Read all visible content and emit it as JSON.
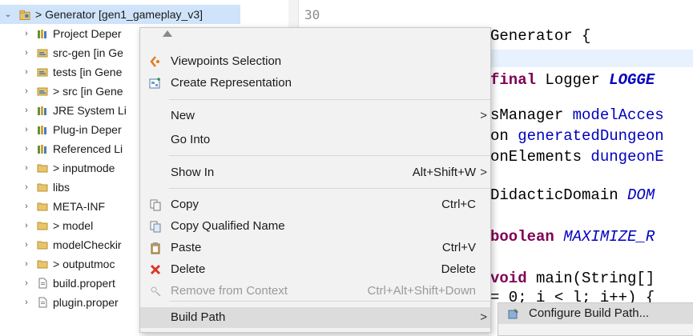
{
  "tree": {
    "root": {
      "prefix": "> ",
      "name": "Generator",
      "detail": "[gen1_gameplay_v3]"
    },
    "items": [
      {
        "label": "Project Deper",
        "icon": "library-icon"
      },
      {
        "label": "src-gen [in Ge",
        "icon": "source-folder-icon"
      },
      {
        "label": "tests [in Gene",
        "icon": "source-folder-icon"
      },
      {
        "label": "> src [in Gene",
        "icon": "source-folder-icon"
      },
      {
        "label": "JRE System Li",
        "icon": "library-icon"
      },
      {
        "label": "Plug-in Deper",
        "icon": "library-icon"
      },
      {
        "label": "Referenced Li",
        "icon": "library-icon"
      },
      {
        "label": "> inputmode",
        "icon": "folder-icon"
      },
      {
        "label": "libs",
        "icon": "folder-icon"
      },
      {
        "label": "META-INF",
        "icon": "folder-icon"
      },
      {
        "label": "> model",
        "icon": "folder-icon"
      },
      {
        "label": "modelCheckir",
        "icon": "folder-icon"
      },
      {
        "label": "> outputmoc",
        "icon": "folder-icon"
      },
      {
        "label": "build.propert",
        "icon": "file-icon"
      },
      {
        "label": "plugin.proper",
        "icon": "file-icon"
      }
    ]
  },
  "editor": {
    "line_number": "30",
    "lines": [
      {
        "parts": [
          {
            "t": "Generator {",
            "c": ""
          }
        ]
      },
      {
        "parts": [
          {
            "t": "final",
            "c": "kw"
          },
          {
            "t": " Logger ",
            "c": ""
          },
          {
            "t": "LOGGE",
            "c": "sfld"
          }
        ]
      },
      {
        "parts": [
          {
            "t": "sManager ",
            "c": ""
          },
          {
            "t": "modelAcces",
            "c": "fld"
          }
        ]
      },
      {
        "parts": [
          {
            "t": "on ",
            "c": ""
          },
          {
            "t": "generatedDungeon",
            "c": "fld"
          }
        ]
      },
      {
        "parts": [
          {
            "t": "onElements ",
            "c": ""
          },
          {
            "t": "dungeonE",
            "c": "fld"
          }
        ]
      },
      {
        "parts": [
          {
            "t": "DidacticDomain ",
            "c": ""
          },
          {
            "t": "DOM",
            "c": "sfld2"
          }
        ]
      },
      {
        "parts": [
          {
            "t": "boolean",
            "c": "kw"
          },
          {
            "t": " ",
            "c": ""
          },
          {
            "t": "MAXIMIZE_R",
            "c": "sfld2"
          }
        ]
      },
      {
        "parts": [
          {
            "t": "void",
            "c": "kw"
          },
          {
            "t": " main(String[]",
            "c": ""
          }
        ]
      },
      {
        "parts": [
          {
            "t": "= 0; i < l; i++) {",
            "c": ""
          }
        ]
      }
    ]
  },
  "menu": {
    "items": [
      {
        "label": "Viewpoints Selection",
        "icon": "viewpoints-icon",
        "shortcut": "",
        "submenu": false,
        "disabled": false
      },
      {
        "label": "Create Representation",
        "icon": "create-representation-icon",
        "shortcut": "",
        "submenu": false,
        "disabled": false
      },
      {
        "label": "New",
        "icon": "",
        "shortcut": "",
        "submenu": true,
        "disabled": false
      },
      {
        "label": "Go Into",
        "icon": "",
        "shortcut": "",
        "submenu": false,
        "disabled": false
      },
      {
        "label": "Show In",
        "icon": "",
        "shortcut": "Alt+Shift+W",
        "submenu": true,
        "disabled": false
      },
      {
        "label": "Copy",
        "icon": "copy-icon",
        "shortcut": "Ctrl+C",
        "submenu": false,
        "disabled": false
      },
      {
        "label": "Copy Qualified Name",
        "icon": "copy-qualified-name-icon",
        "shortcut": "",
        "submenu": false,
        "disabled": false
      },
      {
        "label": "Paste",
        "icon": "paste-icon",
        "shortcut": "Ctrl+V",
        "submenu": false,
        "disabled": false
      },
      {
        "label": "Delete",
        "icon": "delete-icon",
        "shortcut": "Delete",
        "submenu": false,
        "disabled": false
      },
      {
        "label": "Remove from Context",
        "icon": "remove-context-icon",
        "shortcut": "Ctrl+Alt+Shift+Down",
        "submenu": false,
        "disabled": true
      },
      {
        "label": "Build Path",
        "icon": "",
        "shortcut": "",
        "submenu": true,
        "disabled": false
      }
    ],
    "arrow_glyph": ">"
  },
  "submenu": {
    "items": [
      {
        "label": "Configure Build Path...",
        "icon": "configure-build-path-icon"
      }
    ]
  },
  "colors": {
    "menu_bg": "#f2f2f2",
    "hover_bg": "#dcdcdc",
    "delete_icon": "#d9362b",
    "keyword": "#7f0055",
    "field": "#0000c0"
  }
}
